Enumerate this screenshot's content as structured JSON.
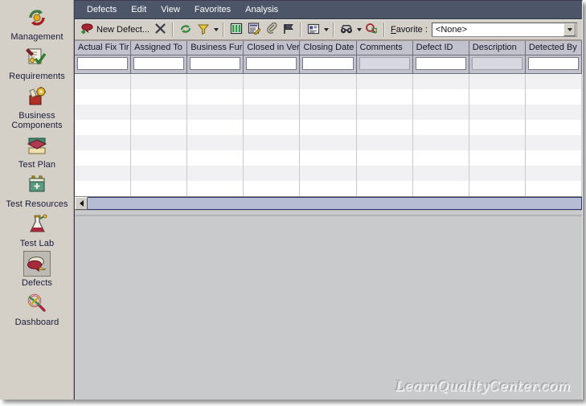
{
  "sidebar": {
    "items": [
      {
        "label": "Management",
        "icon": "management-icon",
        "selected": false
      },
      {
        "label": "Requirements",
        "icon": "requirements-icon",
        "selected": false
      },
      {
        "label": "Business Components",
        "icon": "business-components-icon",
        "selected": false
      },
      {
        "label": "Test Plan",
        "icon": "test-plan-icon",
        "selected": false
      },
      {
        "label": "Test Resources",
        "icon": "test-resources-icon",
        "selected": false
      },
      {
        "label": "Test Lab",
        "icon": "test-lab-icon",
        "selected": false
      },
      {
        "label": "Defects",
        "icon": "defects-icon",
        "selected": true
      },
      {
        "label": "Dashboard",
        "icon": "dashboard-icon",
        "selected": false
      }
    ]
  },
  "menubar": {
    "items": [
      "Defects",
      "Edit",
      "View",
      "Favorites",
      "Analysis"
    ]
  },
  "toolbar": {
    "new_defect_label": "New Defect...",
    "favorite_label_prefix": "F",
    "favorite_label_rest": "avorite :",
    "favorite_value": "<None>",
    "icons": [
      "new-defect-icon",
      "delete-icon",
      "refresh-icon",
      "filter-icon",
      "columns-icon",
      "report-icon",
      "attachment-icon",
      "flag-icon",
      "defect-details-icon",
      "find-icon",
      "search-icon"
    ]
  },
  "grid": {
    "columns": [
      {
        "label": "Actual Fix Tir",
        "filterable": true
      },
      {
        "label": "Assigned To",
        "filterable": true
      },
      {
        "label": "Business Fur",
        "filterable": true
      },
      {
        "label": "Closed in Ver",
        "filterable": true
      },
      {
        "label": "Closing Date",
        "filterable": true
      },
      {
        "label": "Comments",
        "filterable": false
      },
      {
        "label": "Defect ID",
        "filterable": true
      },
      {
        "label": "Description",
        "filterable": false
      },
      {
        "label": "Detected By",
        "filterable": true
      }
    ],
    "row_count": 8,
    "rows": []
  },
  "watermark": "LearnQualityCenter.com",
  "colors": {
    "menubar_bg": "#4d5668",
    "toolbar_bg": "#d4d0c8",
    "header_bg": "#c2c2cc",
    "row_alt": "#f1f1f3",
    "scroll_track": "#b6bcd4",
    "detail_pane": "#c8cacc"
  }
}
